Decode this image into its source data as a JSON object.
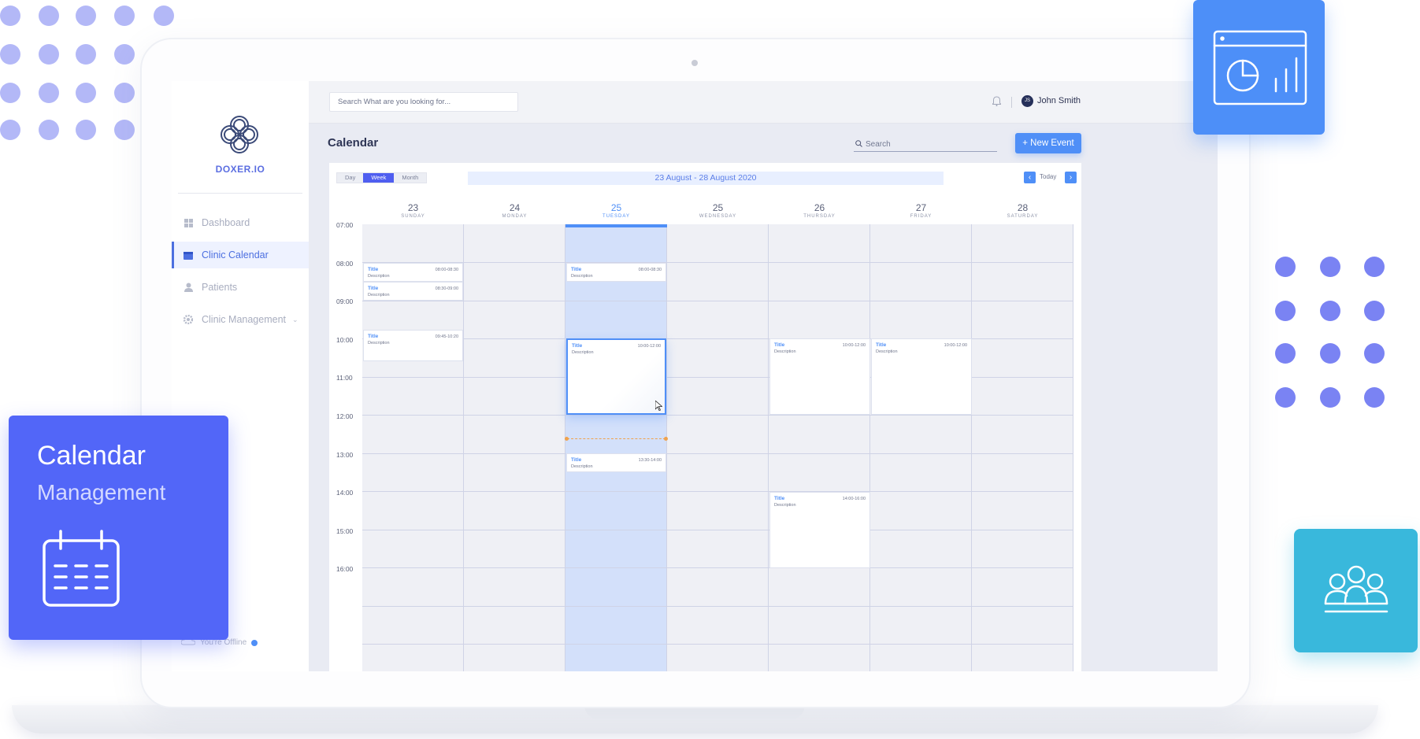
{
  "app": {
    "brand": "DOXER.IO",
    "search_placeholder": "Search What are you looking for...",
    "user_name": "John Smith",
    "user_initials": "JS"
  },
  "sidebar": {
    "items": [
      {
        "label": "Dashboard",
        "icon": "dashboard-icon",
        "active": false
      },
      {
        "label": "Clinic Calendar",
        "icon": "calendar-icon",
        "active": true
      },
      {
        "label": "Patients",
        "icon": "person-icon",
        "active": false
      },
      {
        "label": "Clinic Management",
        "icon": "gear-icon",
        "active": false
      }
    ],
    "offline_label": "You're Offline"
  },
  "calendar": {
    "title": "Calendar",
    "search_placeholder": "Search",
    "new_event_label": "+ New Event",
    "views": [
      "Day",
      "Week",
      "Month"
    ],
    "selected_view": "Week",
    "date_range": "23 August - 28 August 2020",
    "today_label": "Today",
    "days": [
      {
        "num": "23",
        "name": "SUNDAY"
      },
      {
        "num": "24",
        "name": "MONDAY"
      },
      {
        "num": "25",
        "name": "TUESDAY",
        "today": true
      },
      {
        "num": "25",
        "name": "WEDNESDAY"
      },
      {
        "num": "26",
        "name": "THURSDAY"
      },
      {
        "num": "27",
        "name": "FRIDAY"
      },
      {
        "num": "28",
        "name": "SATURDAY"
      }
    ],
    "times": [
      "07:00",
      "08:00",
      "09:00",
      "10:00",
      "11:00",
      "12:00",
      "13:00",
      "14:00",
      "15:00",
      "16:00"
    ],
    "events": [
      {
        "title": "Title",
        "description": "Description",
        "time": "08:00-08:30",
        "day": 0
      },
      {
        "title": "Title",
        "description": "Description",
        "time": "08:30-09:00",
        "day": 0
      },
      {
        "title": "Title",
        "description": "Description",
        "time": "09:45-10:20",
        "day": 0
      },
      {
        "title": "Title",
        "description": "Description",
        "time": "08:00-08:30",
        "day": 2
      },
      {
        "title": "Title",
        "description": "Description",
        "time": "10:00-12:00",
        "day": 2,
        "selected": true
      },
      {
        "title": "Title",
        "description": "Description",
        "time": "13:30-14:00",
        "day": 2
      },
      {
        "title": "Title",
        "description": "Description",
        "time": "10:00-12:00",
        "day": 4
      },
      {
        "title": "Title",
        "description": "Description",
        "time": "10:00-12:00",
        "day": 5
      },
      {
        "title": "Title",
        "description": "Description",
        "time": "14:00-16:00",
        "day": 4
      }
    ]
  },
  "promo": {
    "title": "Calendar",
    "subtitle": "Management"
  },
  "colors": {
    "accent": "#4f8ff7",
    "promo_card": "#5266f8",
    "chart_card": "#4d8ff8",
    "users_card": "#39b8dc",
    "today_column": "#d3e0fa"
  }
}
